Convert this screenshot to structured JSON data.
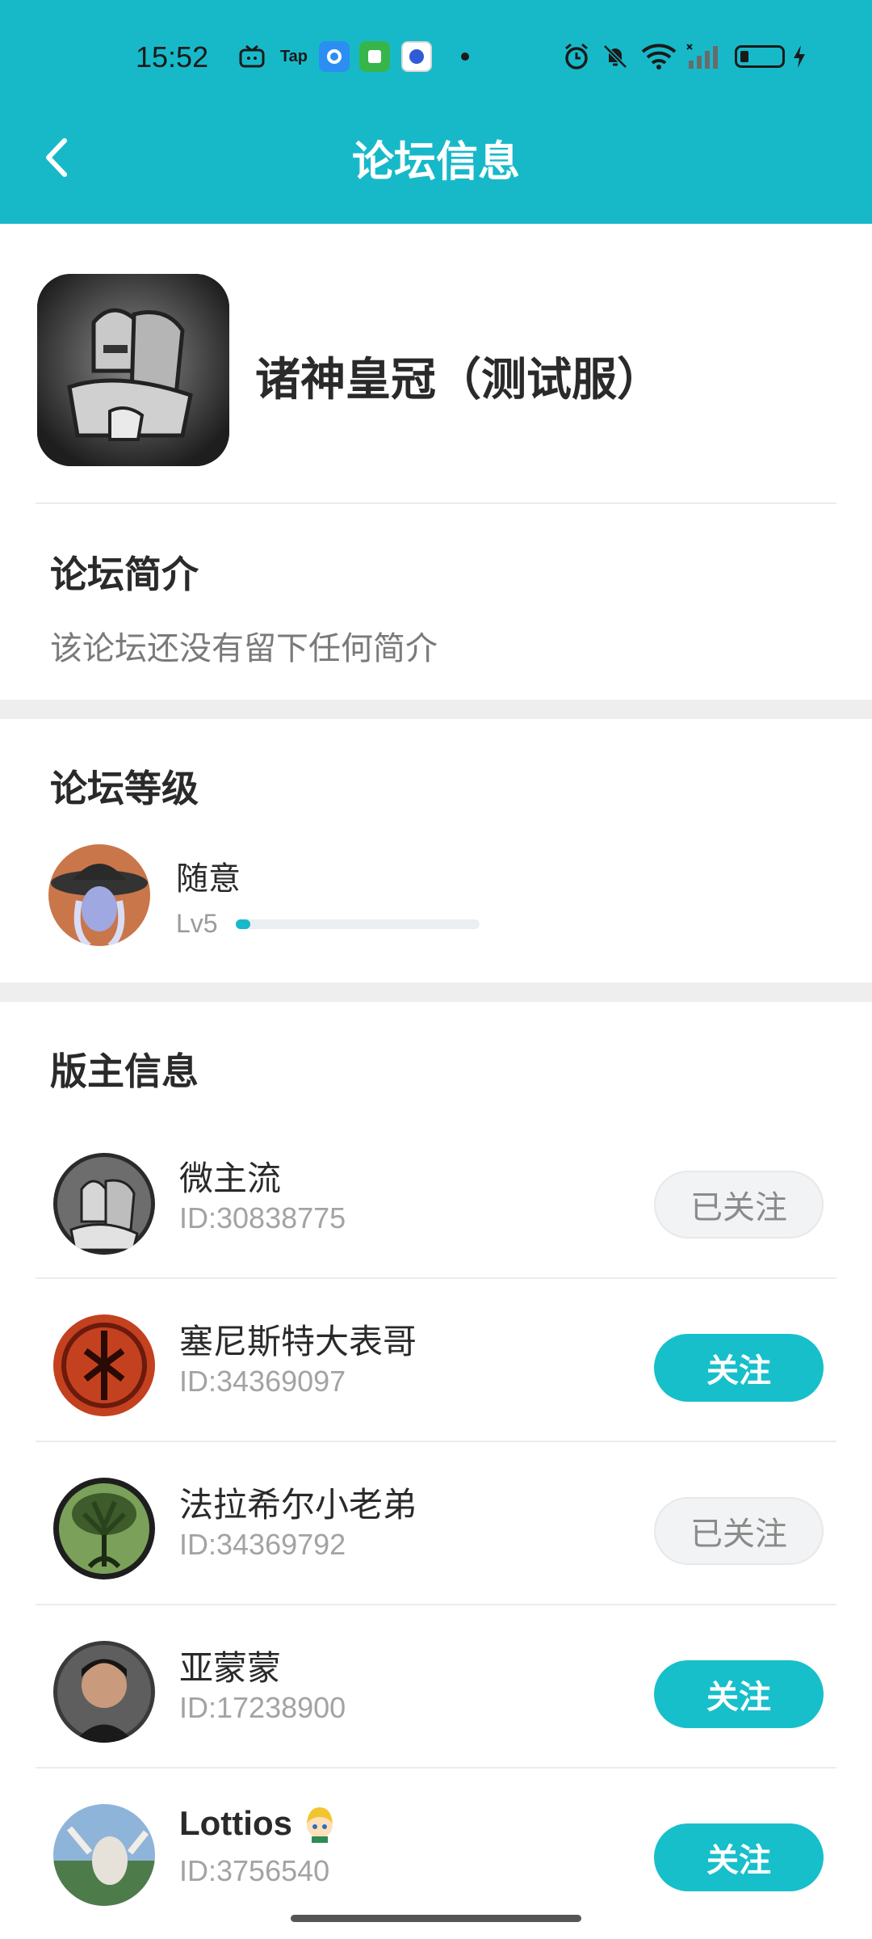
{
  "status_bar": {
    "time": "15:52",
    "tap_label": "Tap"
  },
  "header": {
    "title": "论坛信息"
  },
  "forum": {
    "name": "诸神皇冠（测试服）"
  },
  "intro": {
    "title": "论坛简介",
    "text": "该论坛还没有留下任何简介"
  },
  "level": {
    "title": "论坛等级",
    "name": "随意",
    "tag": "Lv5",
    "progress": 0.06
  },
  "moderators": {
    "title": "版主信息",
    "items": [
      {
        "name": "微主流",
        "id": "ID:30838775",
        "button": "已关注",
        "followed": true
      },
      {
        "name": "塞尼斯特大表哥",
        "id": "ID:34369097",
        "button": "关注",
        "followed": false
      },
      {
        "name": "法拉希尔小老弟",
        "id": "ID:34369792",
        "button": "已关注",
        "followed": true
      },
      {
        "name": "亚蒙蒙",
        "id": "ID:17238900",
        "button": "关注",
        "followed": false
      },
      {
        "name": "Lottios",
        "id": "ID:3756540",
        "button": "关注",
        "followed": false
      }
    ]
  },
  "colors": {
    "accent": "#17b9c9",
    "followed_bg": "#f2f3f4"
  }
}
